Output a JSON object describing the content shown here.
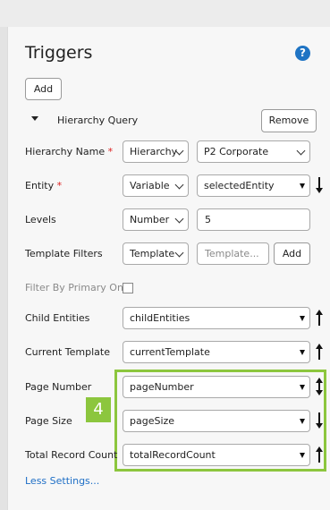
{
  "header": {
    "title": "Triggers",
    "help_icon": "question-circle-icon"
  },
  "toolbar": {
    "add_label": "Add"
  },
  "section": {
    "label": "Hierarchy Query",
    "remove_label": "Remove"
  },
  "fields": {
    "hierarchy_name": {
      "label": "Hierarchy Name",
      "required_mark": "*",
      "type_value": "Hierarchy",
      "value": "P2 Corporate"
    },
    "entity": {
      "label": "Entity",
      "required_mark": "*",
      "type_value": "Variable",
      "value": "selectedEntity",
      "sort_icon": "arrow-down-icon"
    },
    "levels": {
      "label": "Levels",
      "type_value": "Number",
      "value": "5"
    },
    "template_filters": {
      "label": "Template Filters",
      "type_value": "Template",
      "placeholder": "Template...",
      "add_label": "Add"
    },
    "filter_by_primary_only": {
      "label": "Filter By Primary Only",
      "checked": false
    },
    "child_entities": {
      "label": "Child Entities",
      "value": "childEntities",
      "sort_icon": "arrow-up-icon"
    },
    "current_template": {
      "label": "Current Template",
      "value": "currentTemplate",
      "sort_icon": "arrow-up-icon"
    },
    "page_number": {
      "label": "Page Number",
      "value": "pageNumber",
      "sort_icon": "arrow-up-down-icon"
    },
    "page_size": {
      "label": "Page Size",
      "value": "pageSize",
      "sort_icon": "arrow-down-icon"
    },
    "total_record_count": {
      "label": "Total Record Count",
      "value": "totalRecordCount",
      "sort_icon": "arrow-up-icon"
    }
  },
  "callout": {
    "number": "4",
    "color": "#8cc63e"
  },
  "footer": {
    "less_settings_label": "Less Settings..."
  },
  "colors": {
    "link": "#1f6fc6",
    "help": "#1f74c4",
    "required": "#dd2222"
  }
}
